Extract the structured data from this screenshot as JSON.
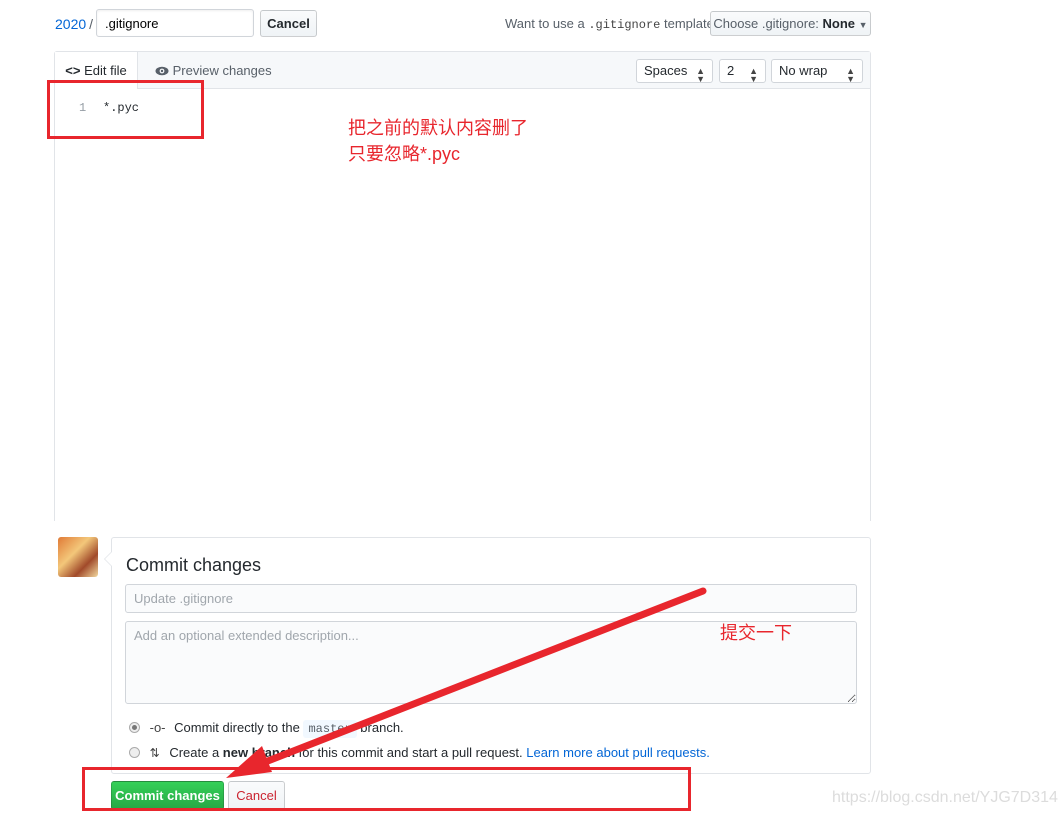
{
  "header": {
    "breadcrumb_repo": "2020",
    "breadcrumb_sep": "/",
    "filename_value": ".gitignore",
    "cancel_label": "Cancel",
    "template_question_pre": "Want to use a ",
    "template_question_code": ".gitignore",
    "template_question_post": " template?",
    "template_button_prefix": "Choose .gitignore: ",
    "template_button_value": "None"
  },
  "editor": {
    "tabs": [
      {
        "label": "Edit file",
        "icon": "code-icon",
        "active": true
      },
      {
        "label": "Preview changes",
        "icon": "eye-icon",
        "active": false
      }
    ],
    "indent_mode": "Spaces",
    "indent_size": "2",
    "wrap_mode": "No wrap",
    "lines": [
      {
        "number": "1",
        "text": "*.pyc"
      }
    ]
  },
  "annotations": {
    "editor_note_line1": "把之前的默认内容删了",
    "editor_note_line2": "只要忽略*.pyc",
    "commit_note": "提交一下",
    "accent_color": "#e8262d"
  },
  "commit": {
    "title": "Commit changes",
    "summary_placeholder": "Update .gitignore",
    "description_placeholder": "Add an optional extended description...",
    "option_direct_pre": "Commit directly to the ",
    "option_direct_branch": "master",
    "option_direct_post": " branch.",
    "option_new_pre": "Create a ",
    "option_new_bold": "new branch",
    "option_new_post": " for this commit and start a pull request. ",
    "option_new_link": "Learn more about pull requests.",
    "selected_option": "direct",
    "commit_button_label": "Commit changes",
    "cancel_button_label": "Cancel"
  },
  "watermark": "https://blog.csdn.net/YJG7D314"
}
